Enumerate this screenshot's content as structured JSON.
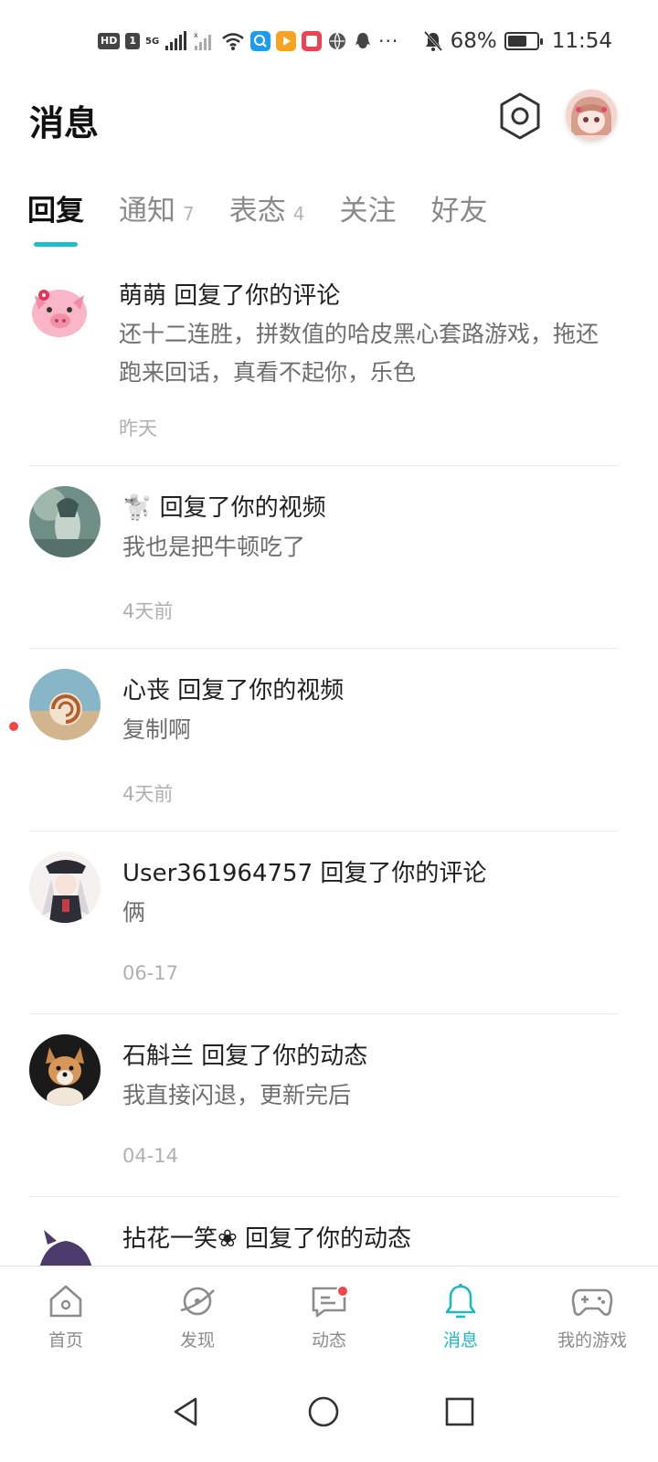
{
  "status_bar": {
    "hd": "HD",
    "sim": "1",
    "network": "5G",
    "battery_text": "68%",
    "battery_level": 0.68,
    "time": "11:54",
    "more": "···"
  },
  "header": {
    "title": "消息"
  },
  "tabs": [
    {
      "label": "回复",
      "count": "",
      "active": true
    },
    {
      "label": "通知",
      "count": "7",
      "active": false
    },
    {
      "label": "表态",
      "count": "4",
      "active": false
    },
    {
      "label": "关注",
      "count": "",
      "active": false
    },
    {
      "label": "好友",
      "count": "",
      "active": false
    }
  ],
  "messages": [
    {
      "title": "萌萌 回复了你的评论",
      "body": "还十二连胜，拼数值的哈皮黑心套路游戏，拖还跑来回话，真看不起你，乐色",
      "time": "昨天",
      "unread": false
    },
    {
      "title": "🐩 回复了你的视频",
      "body": "我也是把牛顿吃了",
      "time": "4天前",
      "unread": false
    },
    {
      "title": "心丧 回复了你的视频",
      "body": "复制啊",
      "time": "4天前",
      "unread": true
    },
    {
      "title": "User361964757 回复了你的评论",
      "body": "俩",
      "time": "06-17",
      "unread": false
    },
    {
      "title": "石斛兰 回复了你的动态",
      "body": "我直接闪退，更新完后",
      "time": "04-14",
      "unread": false
    },
    {
      "title": "拈花一笑❀ 回复了你的动态",
      "body": "",
      "time": "",
      "unread": false
    }
  ],
  "bottom_nav": [
    {
      "label": "首页",
      "icon": "home-icon",
      "active": false
    },
    {
      "label": "发现",
      "icon": "planet-icon",
      "active": false
    },
    {
      "label": "动态",
      "icon": "chat-icon",
      "active": false,
      "badge": true
    },
    {
      "label": "消息",
      "icon": "bell-icon",
      "active": true
    },
    {
      "label": "我的游戏",
      "icon": "gamepad-icon",
      "active": false
    }
  ],
  "colors": {
    "accent": "#1cc0ca",
    "badge": "#f04848",
    "title_text": "#111111",
    "secondary_text": "#6e6e6e",
    "time_text": "#b0b0b0"
  }
}
